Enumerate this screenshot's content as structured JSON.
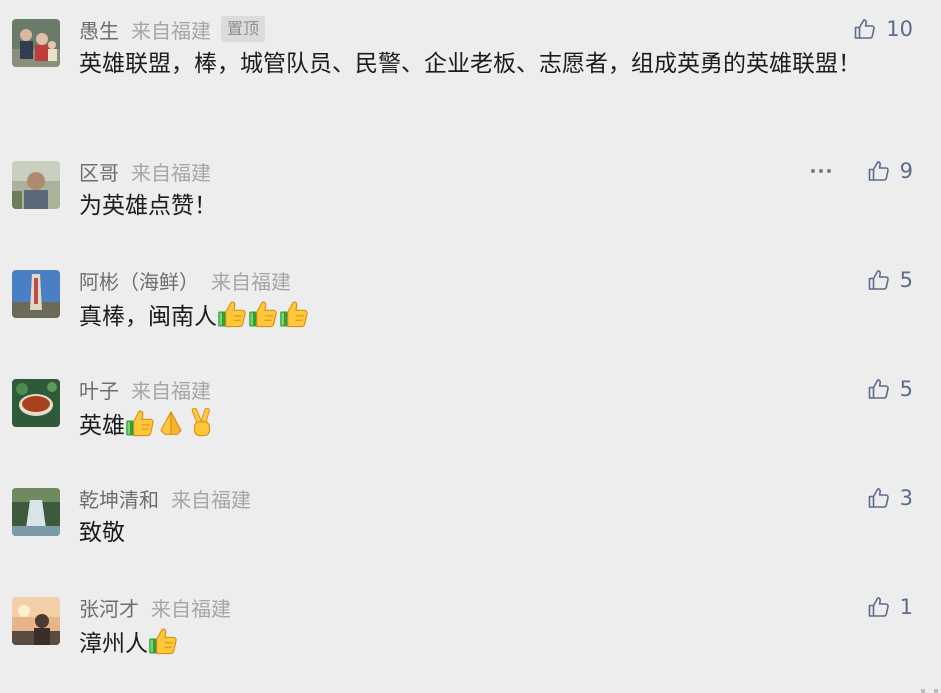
{
  "colors": {
    "background": "#ededed",
    "name": "#6e6e6e",
    "location": "#a6a6a6",
    "like": "#5c6c8c",
    "text": "#1c1c1c"
  },
  "comments": [
    {
      "name": "愚生",
      "location": "来自福建",
      "pinned_label": "置顶",
      "text": "英雄联盟，棒，城管队员、民警、企业老板、志愿者，组成英勇的英雄联盟！",
      "likes": "10",
      "avatar_icon": "family-photo-avatar"
    },
    {
      "name": "区哥",
      "location": "来自福建",
      "text": "为英雄点赞！",
      "likes": "9",
      "avatar_icon": "man-photo-avatar"
    },
    {
      "name": "阿彬（海鲜）",
      "location": "来自福建",
      "text": "真棒，闽南人",
      "emojis": [
        "thumbs-up-emoji",
        "thumbs-up-emoji",
        "thumbs-up-emoji"
      ],
      "likes": "5",
      "avatar_icon": "monument-photo-avatar"
    },
    {
      "name": "叶子",
      "location": "来自福建",
      "text": "英雄",
      "emojis": [
        "thumbs-up-emoji",
        "praying-hands-emoji",
        "victory-hand-emoji"
      ],
      "likes": "5",
      "avatar_icon": "tea-cup-photo-avatar"
    },
    {
      "name": "乾坤清和",
      "location": "来自福建",
      "text": "致敬",
      "likes": "3",
      "avatar_icon": "waterfall-photo-avatar"
    },
    {
      "name": "张河才",
      "location": "来自福建",
      "text": "漳州人",
      "emojis": [
        "thumbs-up-emoji"
      ],
      "likes": "1",
      "avatar_icon": "sunset-portrait-avatar"
    }
  ]
}
